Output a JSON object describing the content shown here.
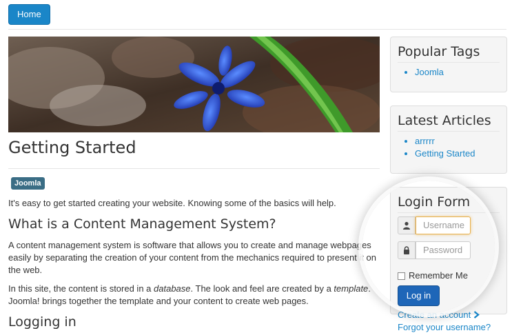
{
  "nav": {
    "home_label": "Home"
  },
  "article": {
    "title": "Getting Started",
    "tag": "Joomla",
    "intro": "It's easy to get started creating your website. Knowing some of the basics will help.",
    "section1_heading": "What is a Content Management System?",
    "section1_text": "A content management system is software that allows you to create and manage webpages easily by separating the creation of your content from the mechanics required to present it on the web.",
    "section2_text_a": "In this site, the content is stored in a ",
    "section2_text_em1": "database",
    "section2_text_b": ". The look and feel are created by a ",
    "section2_text_em2": "template",
    "section2_text_c": ". Joomla! brings together the template and your content to create web pages.",
    "section3_heading": "Logging in"
  },
  "sidebar": {
    "popular_tags": {
      "title": "Popular Tags",
      "items": [
        "Joomla"
      ]
    },
    "latest_articles": {
      "title": "Latest Articles",
      "items": [
        "arrrrr",
        "Getting Started"
      ]
    },
    "login": {
      "title": "Login Form",
      "username_placeholder": "Username",
      "password_placeholder": "Password",
      "remember_label": "Remember Me",
      "login_button": "Log in",
      "create_account": "Create an account",
      "forgot_username": "Forgot your username?"
    }
  },
  "colors": {
    "accent": "#1a86c8",
    "tag": "#3a6d85",
    "login_button": "#1e66b8"
  },
  "icons": {
    "user": "user-icon",
    "lock": "lock-icon",
    "chevron": "chevron-right-icon"
  }
}
